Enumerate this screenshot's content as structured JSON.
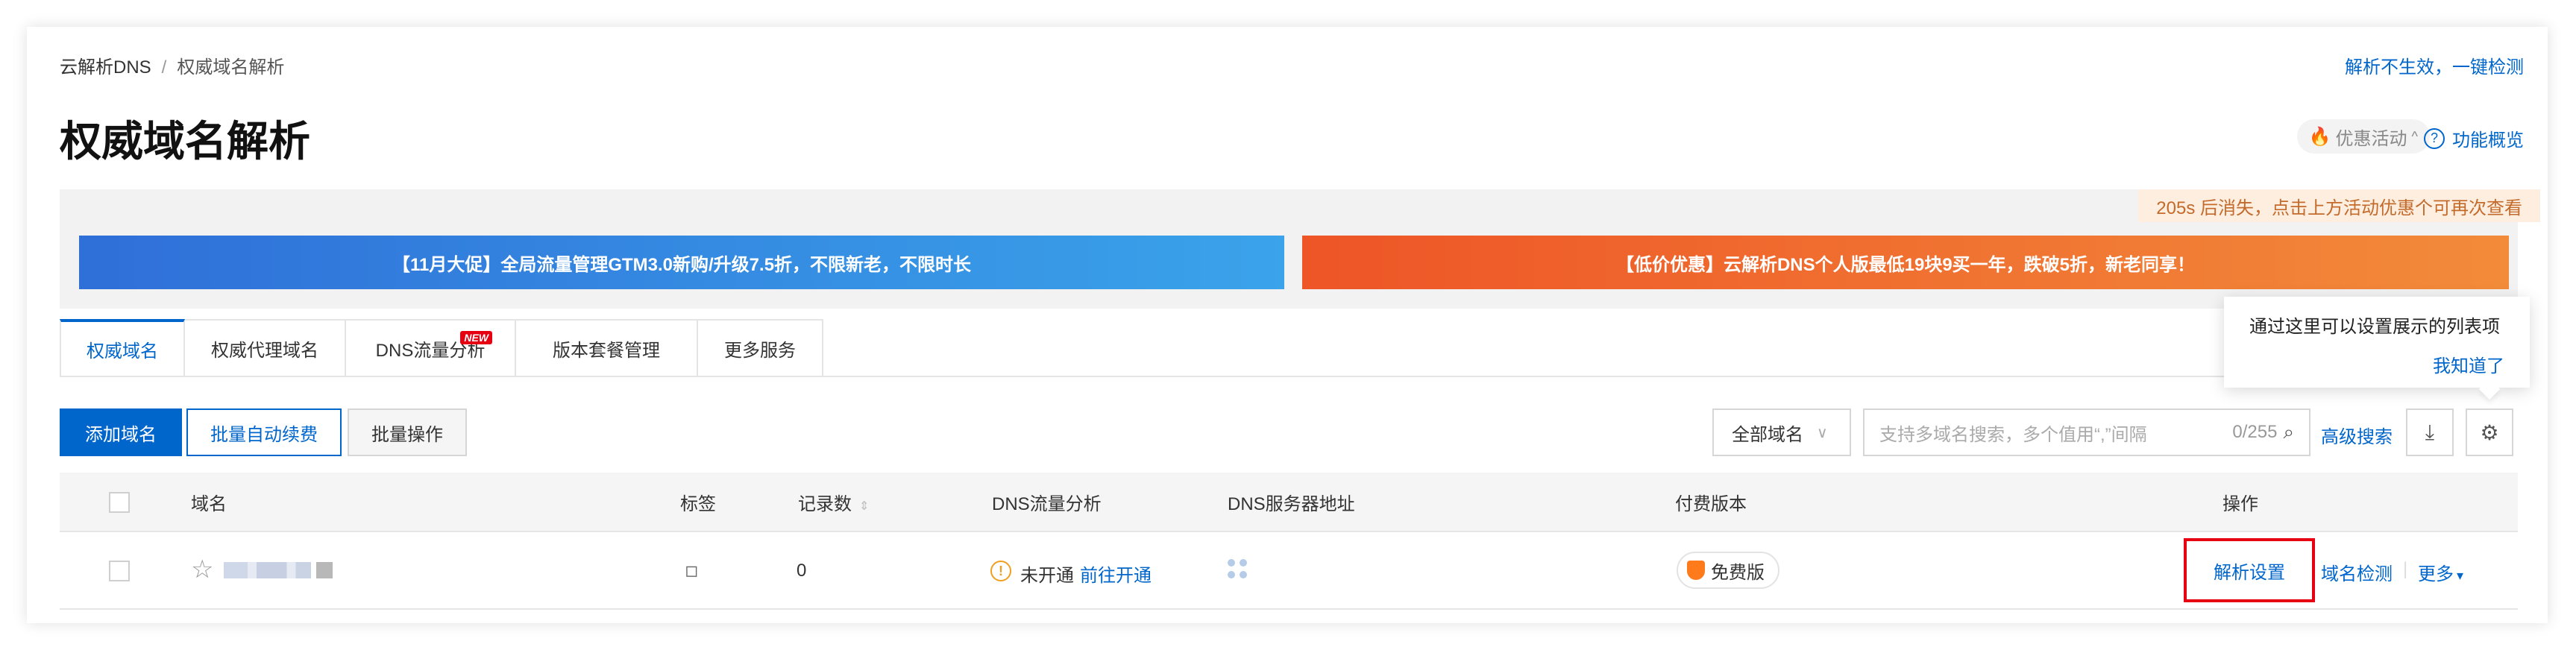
{
  "breadcrumb": {
    "root": "云解析DNS",
    "separator": "/",
    "current": "权威域名解析"
  },
  "top_link": "解析不生效，一键检测",
  "page_title": "权威域名解析",
  "header_actions": {
    "promo": "优惠活动",
    "promo_chevron": "^",
    "overview": "功能概览",
    "overview_icon": "?"
  },
  "countdown": "205s 后消失，点击上方活动优惠个可再次查看",
  "banners": {
    "left": "【11月大促】全局流量管理GTM3.0新购/升级7.5折，不限新老，不限时长",
    "right": "【低价优惠】云解析DNS个人版最低19块9买一年，跌破5折，新老同享！"
  },
  "tabs": [
    {
      "label": "权威域名",
      "active": true
    },
    {
      "label": "权威代理域名",
      "active": false
    },
    {
      "label": "DNS流量分析",
      "active": false,
      "badge": "NEW"
    },
    {
      "label": "版本套餐管理",
      "active": false
    },
    {
      "label": "更多服务",
      "active": false
    }
  ],
  "toolbar": {
    "add": "添加域名",
    "batch_renew": "批量自动续费",
    "batch_ops": "批量操作",
    "domain_filter": "全部域名",
    "filter_chevron": "∨",
    "search_placeholder": "支持多域名搜索，多个值用“,”间隔",
    "search_count": "0/255",
    "advanced_search": "高级搜索"
  },
  "popover": {
    "text": "通过这里可以设置展示的列表项",
    "confirm": "我知道了"
  },
  "table": {
    "headers": {
      "domain": "域名",
      "tags": "标签",
      "records": "记录数",
      "dns_analysis": "DNS流量分析",
      "dns_servers": "DNS服务器地址",
      "edition": "付费版本",
      "actions": "操作"
    },
    "rows": [
      {
        "record_count": "0",
        "analysis_status": "未开通",
        "analysis_link": "前往开通",
        "edition": "免费版",
        "actions": [
          "解析设置",
          "域名检测",
          "更多"
        ]
      }
    ]
  },
  "icons": {
    "flame": "flame-icon",
    "help": "question-circle-icon",
    "search": "search-icon",
    "download": "download-icon",
    "settings": "gear-icon",
    "star": "star-icon",
    "tag": "tag-icon",
    "warning": "warning-icon",
    "servers": "dns-server-icon",
    "edition": "shield-icon",
    "sort": "sort-icon",
    "more": "caret-down-icon"
  },
  "colors": {
    "accent": "#0066cc",
    "highlight": "#e60012",
    "banner_left": "#2f6fd8",
    "banner_right": "#ee5527"
  }
}
